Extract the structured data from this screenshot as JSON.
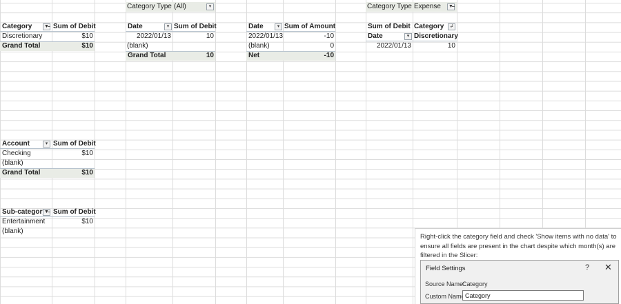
{
  "pivot_category": {
    "header": {
      "field": "Category",
      "value": "Sum of Debit"
    },
    "rows": [
      {
        "label": "Discretionary",
        "value": "$10"
      }
    ],
    "total": {
      "label": "Grand Total",
      "value": "$10"
    }
  },
  "filter_category_type_all": {
    "label": "Category Type",
    "value": "(All)"
  },
  "pivot_date_debit": {
    "header": {
      "field": "Date",
      "value": "Sum of Debit"
    },
    "rows": [
      {
        "label": "2022/01/13",
        "value": "10"
      },
      {
        "label": "(blank)",
        "value": ""
      }
    ],
    "total": {
      "label": "Grand Total",
      "value": "10"
    }
  },
  "pivot_date_amount": {
    "header": {
      "field": "Date",
      "value": "Sum of Amount"
    },
    "rows": [
      {
        "label": "2022/01/13",
        "value": "-10"
      },
      {
        "label": "(blank)",
        "value": "0"
      }
    ],
    "total": {
      "label": "Net",
      "value": "-10"
    }
  },
  "filter_category_type_expense": {
    "label": "Category Type",
    "value": "Expense"
  },
  "pivot_expense": {
    "header1": {
      "left": "Sum of Debit",
      "right": "Category"
    },
    "header2": {
      "left": "Date",
      "right": "Discretionary"
    },
    "rows": [
      {
        "label": "2022/01/13",
        "value": "10"
      }
    ]
  },
  "pivot_account": {
    "header": {
      "field": "Account",
      "value": "Sum of Debit"
    },
    "rows": [
      {
        "label": "Checking",
        "value": "$10"
      },
      {
        "label": "(blank)",
        "value": ""
      }
    ],
    "total": {
      "label": "Grand Total",
      "value": "$10"
    }
  },
  "pivot_subcategory": {
    "header": {
      "field": "Sub-category",
      "value": "Sum of Debit"
    },
    "rows": [
      {
        "label": "Entertainment",
        "value": "$10"
      },
      {
        "label": "(blank)",
        "value": ""
      }
    ]
  },
  "note": {
    "text": "Right-click the category field and check 'Show items with no data' to ensure all fields are present in the chart despite which month(s) are filtered in the Slicer:"
  },
  "dialog": {
    "title": "Field Settings",
    "help": "?",
    "close": "✕",
    "source_label": "Source Name:",
    "source_value": "Category",
    "custom_label": "Custom Name:",
    "custom_value": "Category"
  },
  "icons": {
    "dropdown": "▾",
    "filter": "▼̶",
    "sort": "↲"
  }
}
